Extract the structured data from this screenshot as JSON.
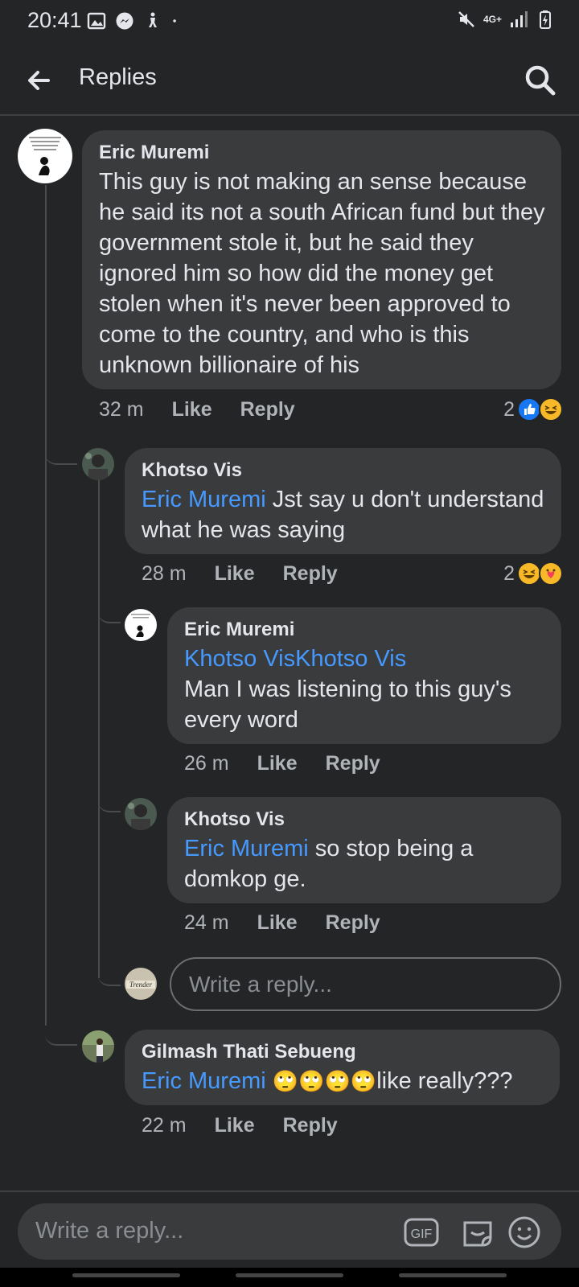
{
  "status": {
    "time": "20:41",
    "network": "4G+"
  },
  "appbar": {
    "title": "Replies"
  },
  "comments": [
    {
      "author": "Eric Muremi",
      "text": "This guy is not making an sense because he said its not a south African fund but they government stole it, but he said they ignored him so how did the money get stolen when it's never been approved to come to the country, and who is this unknown billionaire of his",
      "time": "32 m",
      "like": "Like",
      "reply": "Reply",
      "reaction_count": "2"
    },
    {
      "author": "Khotso Vis",
      "mention": "Eric Muremi",
      "text": " Jst say u don't understand what he was saying",
      "time": "28 m",
      "like": "Like",
      "reply": "Reply",
      "reaction_count": "2"
    },
    {
      "author": "Eric Muremi",
      "mention": "Khotso VisKhotso Vis",
      "text": "Man I was listening to this guy's every word",
      "time": "26 m",
      "like": "Like",
      "reply": "Reply"
    },
    {
      "author": "Khotso Vis",
      "mention": "Eric Muremi",
      "text": " so stop being a domkop ge.",
      "time": "24 m",
      "like": "Like",
      "reply": "Reply"
    },
    {
      "author": "Gilmash Thati Sebueng",
      "mention": "Eric Muremi",
      "emojis": "🙄🙄🙄🙄",
      "text": "like really???",
      "time": "22 m",
      "like": "Like",
      "reply": "Reply"
    }
  ],
  "nested_reply_input": {
    "placeholder": "Write a reply..."
  },
  "composer": {
    "placeholder": "Write a reply...",
    "gif_label": "GIF"
  },
  "colors": {
    "background": "#242526",
    "bubble": "#3a3b3c",
    "mention": "#4599ff",
    "like_reaction": "#1877f2",
    "haha_reaction": "#f7b928"
  }
}
